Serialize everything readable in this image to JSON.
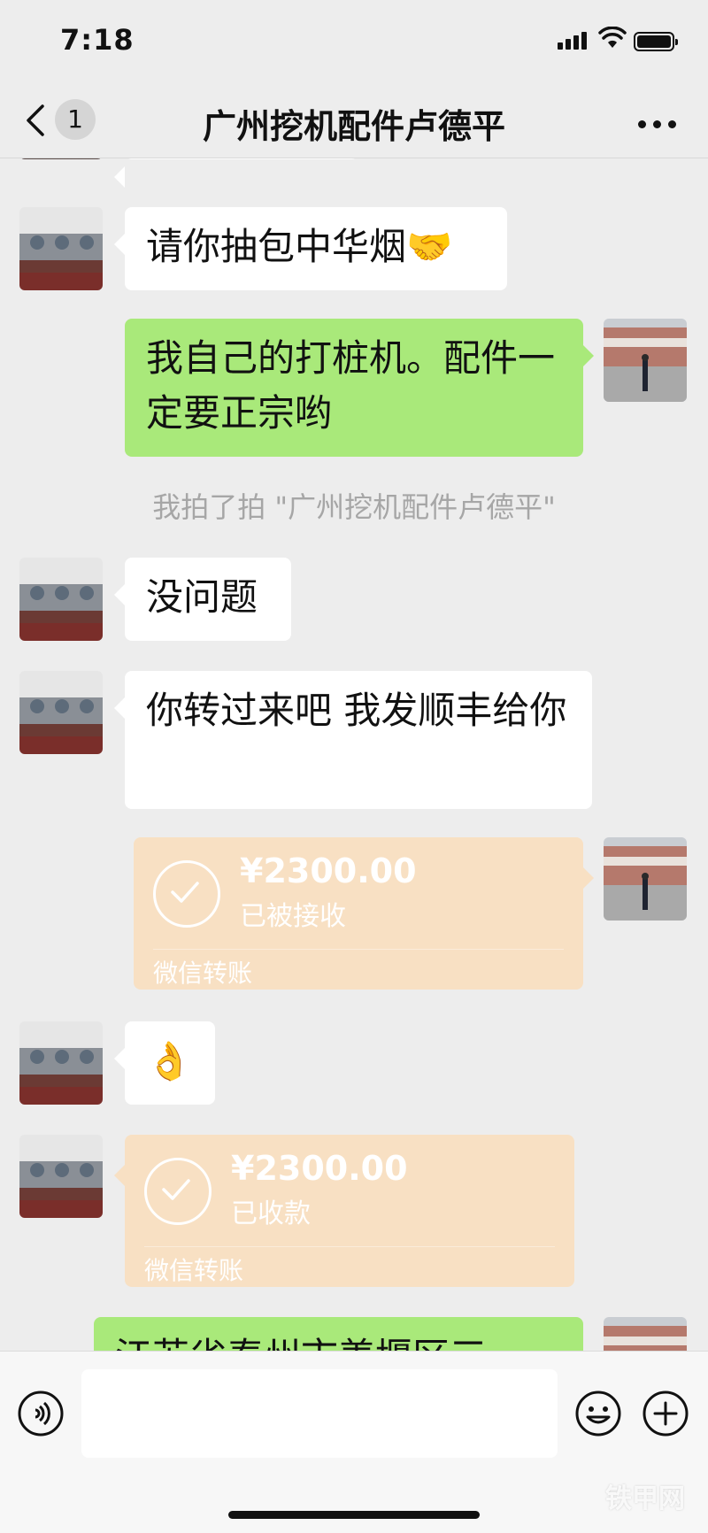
{
  "status_bar": {
    "time": "7:18"
  },
  "header": {
    "back_count": "1",
    "title": "广州挖机配件卢德平"
  },
  "messages": {
    "m1": {
      "text": "请你抽包中华烟🤝"
    },
    "m2": {
      "text": "我自己的打桩机。配件一定要正宗哟"
    },
    "system": {
      "text": "我拍了拍 \"广州挖机配件卢德平\""
    },
    "m3": {
      "text": "没问题"
    },
    "m4": {
      "text": "你转过来吧 我发顺丰给你"
    },
    "t1": {
      "amount": "¥2300.00",
      "status": "已被接收",
      "label": "微信转账"
    },
    "m5": {
      "text": "👌"
    },
    "t2": {
      "amount": "¥2300.00",
      "status": "已收款",
      "label": "微信转账"
    },
    "m6": {
      "text": "江苏省泰州市姜堰区三"
    }
  },
  "input_bar": {
    "placeholder": ""
  },
  "watermark": "铁甲网"
}
